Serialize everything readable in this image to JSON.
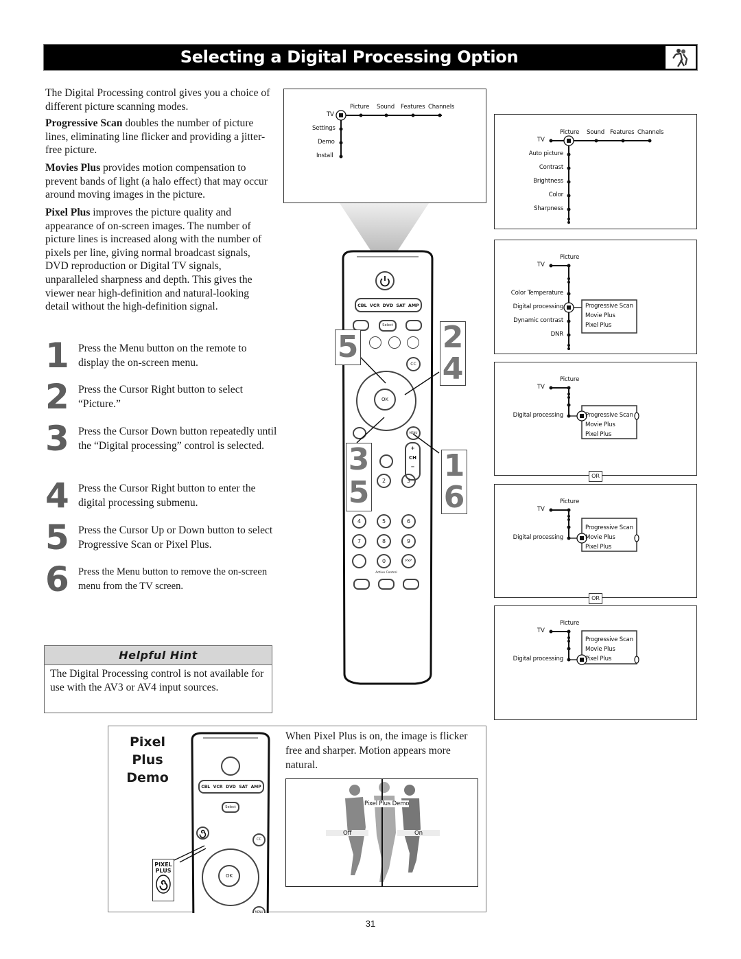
{
  "header": {
    "title": "Selecting a Digital Processing Option",
    "icon": "runners-icon"
  },
  "intro": {
    "p1": "The Digital Processing control gives you a choice of different picture scanning modes.",
    "p2_term": "Progressive Scan",
    "p2_text": " doubles the number of picture lines, eliminating line flicker and providing a jitter-free picture.",
    "p3_term": "Movies Plus",
    "p3_text": " provides motion compensation to prevent bands of light (a halo effect) that may occur around moving images in the picture.",
    "p4_term": "Pixel Plus",
    "p4_text": " improves the picture quality and appearance of on-screen images. The number of picture lines is increased along with the number of pixels per line, giving normal broadcast signals, DVD reproduction or Digital TV signals, unparalleled sharpness and depth. This gives the viewer near high-definition and natural-looking detail without the high-definition signal."
  },
  "steps": [
    {
      "num": "1",
      "text": "Press the Menu button on the remote to display the on-screen menu."
    },
    {
      "num": "2",
      "text": "Press the Cursor Right button to select “Picture.”"
    },
    {
      "num": "3",
      "text": "Press the Cursor Down button repeatedly until the “Digital processing” control is selected."
    },
    {
      "num": "4",
      "text": "Press the Cursor Right button to enter the digital processing submenu."
    },
    {
      "num": "5",
      "text": "Press the Cursor Up or Down button to select Progressive Scan or Pixel Plus."
    },
    {
      "num": "6",
      "text": "Press the Menu button to remove the on-screen menu from the TV screen."
    }
  ],
  "hint": {
    "title": "Helpful Hint",
    "text": "The Digital Processing control is not available for use with the AV3 or AV4 input sources."
  },
  "menu1": {
    "root": "TV",
    "top_items": [
      "Picture",
      "Sound",
      "Features",
      "Channels"
    ],
    "side_items": [
      "Settings",
      "Demo",
      "Install"
    ]
  },
  "menu2": {
    "root": "TV",
    "top_items": [
      "Picture",
      "Sound",
      "Features",
      "Channels"
    ],
    "side_items": [
      "Auto picture",
      "Contrast",
      "Brightness",
      "Color",
      "Sharpness"
    ]
  },
  "menu3": {
    "root": "TV",
    "header": "Picture",
    "side_items": [
      "Color Temperature",
      "Digital processing",
      "Dynamic contrast",
      "DNR"
    ],
    "submenu": [
      "Progressive Scan",
      "Movie Plus",
      "Pixel Plus"
    ]
  },
  "menu4": {
    "root": "TV",
    "header": "Picture",
    "item": "Digital processing",
    "submenu": [
      "Progressive Scan",
      "Movie Plus",
      "Pixel Plus"
    ],
    "selected": "Progressive Scan"
  },
  "menu5": {
    "root": "TV",
    "header": "Picture",
    "item": "Digital processing",
    "submenu": [
      "Progressive Scan",
      "Movie Plus",
      "Pixel Plus"
    ],
    "selected": "Movie Plus"
  },
  "menu6": {
    "root": "TV",
    "header": "Picture",
    "item": "Digital processing",
    "submenu": [
      "Progressive Scan",
      "Movie Plus",
      "Pixel Plus"
    ],
    "selected": "Pixel Plus"
  },
  "or_label": "OR",
  "remote": {
    "source_buttons": [
      "CBL",
      "VCR",
      "DVD",
      "SAT",
      "AMP"
    ],
    "select_label": "Select",
    "ok_label": "OK",
    "cc_label": "CC",
    "menu_label": "MENU",
    "ch_label": "CH",
    "ch_plus": "+",
    "ch_minus": "−",
    "numbers": [
      "2",
      "3",
      "4",
      "5",
      "6",
      "7",
      "8",
      "9",
      "0"
    ],
    "pip_label": "PxP",
    "active_control": "Active Control",
    "callouts": {
      "left_top": "5",
      "right_top": "2\n4",
      "left_bottom": "3\n5",
      "right_bottom": "1\n6"
    }
  },
  "demo": {
    "title_line1": "Pixel",
    "title_line2": "Plus",
    "title_line3": "Demo",
    "description": "When Pixel Plus is on, the image is flicker free and sharper. Motion appears more natural.",
    "pixel_plus_badge_line1": "PIXEL",
    "pixel_plus_badge_line2": "PLUS",
    "image_label": "Pixel Plus Demo",
    "off_label": "Off",
    "on_label": "On"
  },
  "footer": {
    "page_number": "31"
  }
}
